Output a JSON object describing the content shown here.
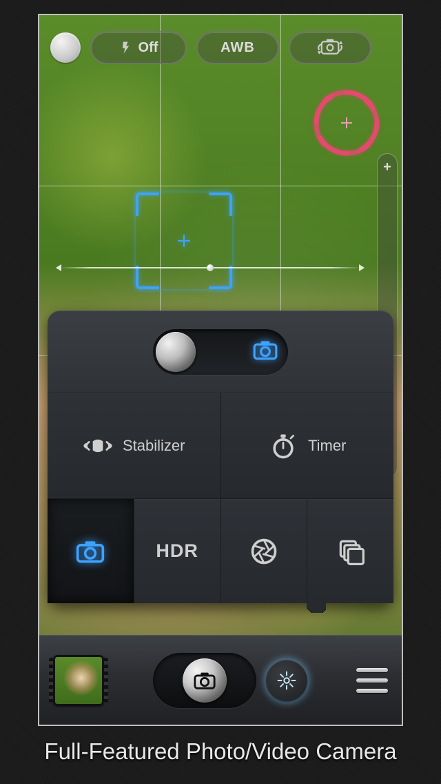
{
  "top": {
    "flash_label": "Off",
    "wb_label": "AWB"
  },
  "zoom": {
    "plus": "+",
    "minus": "–"
  },
  "panel": {
    "stabilizer": "Stabilizer",
    "timer": "Timer",
    "hdr": "HDR"
  },
  "caption": "Full-Featured Photo/Video Camera"
}
